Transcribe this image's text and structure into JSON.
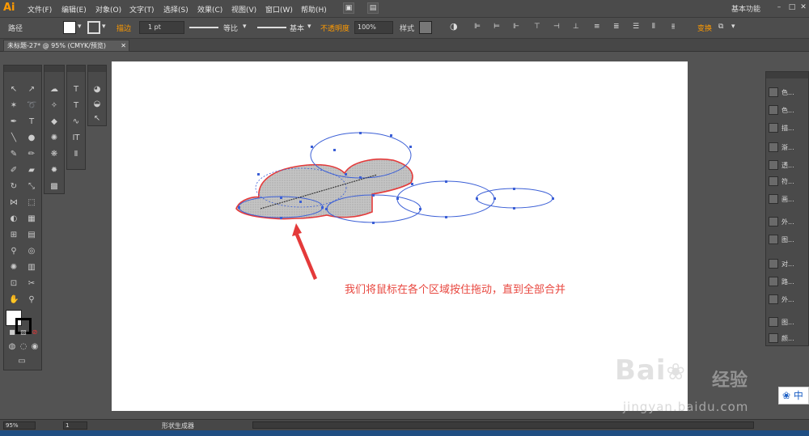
{
  "app": {
    "logo": "Ai",
    "workspace": "基本功能"
  },
  "menu": [
    "文件(F)",
    "编辑(E)",
    "对象(O)",
    "文字(T)",
    "选择(S)",
    "效果(C)",
    "视图(V)",
    "窗口(W)",
    "帮助(H)"
  ],
  "control": {
    "selection_label": "路径",
    "stroke_label": "描边",
    "stroke_weight": "1 pt",
    "stroke_profile": "等比",
    "brush": "基本",
    "opacity_label": "不透明度",
    "opacity_value": "100%",
    "style_label": "样式",
    "transform_label": "变换"
  },
  "document": {
    "tab": "未标题-27* @ 95% (CMYK/预览)"
  },
  "annotation": "我们将鼠标在各个区域按住拖动，直到全部合并",
  "right_panel": [
    "色...",
    "色...",
    "描...",
    "渐...",
    "透...",
    "符...",
    "画...",
    "外...",
    "图...",
    "对...",
    "路...",
    "外...",
    "图...",
    "颜...",
    "颜..."
  ],
  "status": {
    "zoom": "95%",
    "page": "1",
    "tool": "形状生成器"
  },
  "watermark": {
    "brand": "Bai",
    "brand_suffix": "经验",
    "url": "jingyan.baidu.com"
  },
  "side_badge": "中",
  "colors": {
    "accent": "#ff9a00",
    "annotation": "#e8473f",
    "path": "#3b5fd6",
    "merged_fill": "#c8c8c8"
  }
}
